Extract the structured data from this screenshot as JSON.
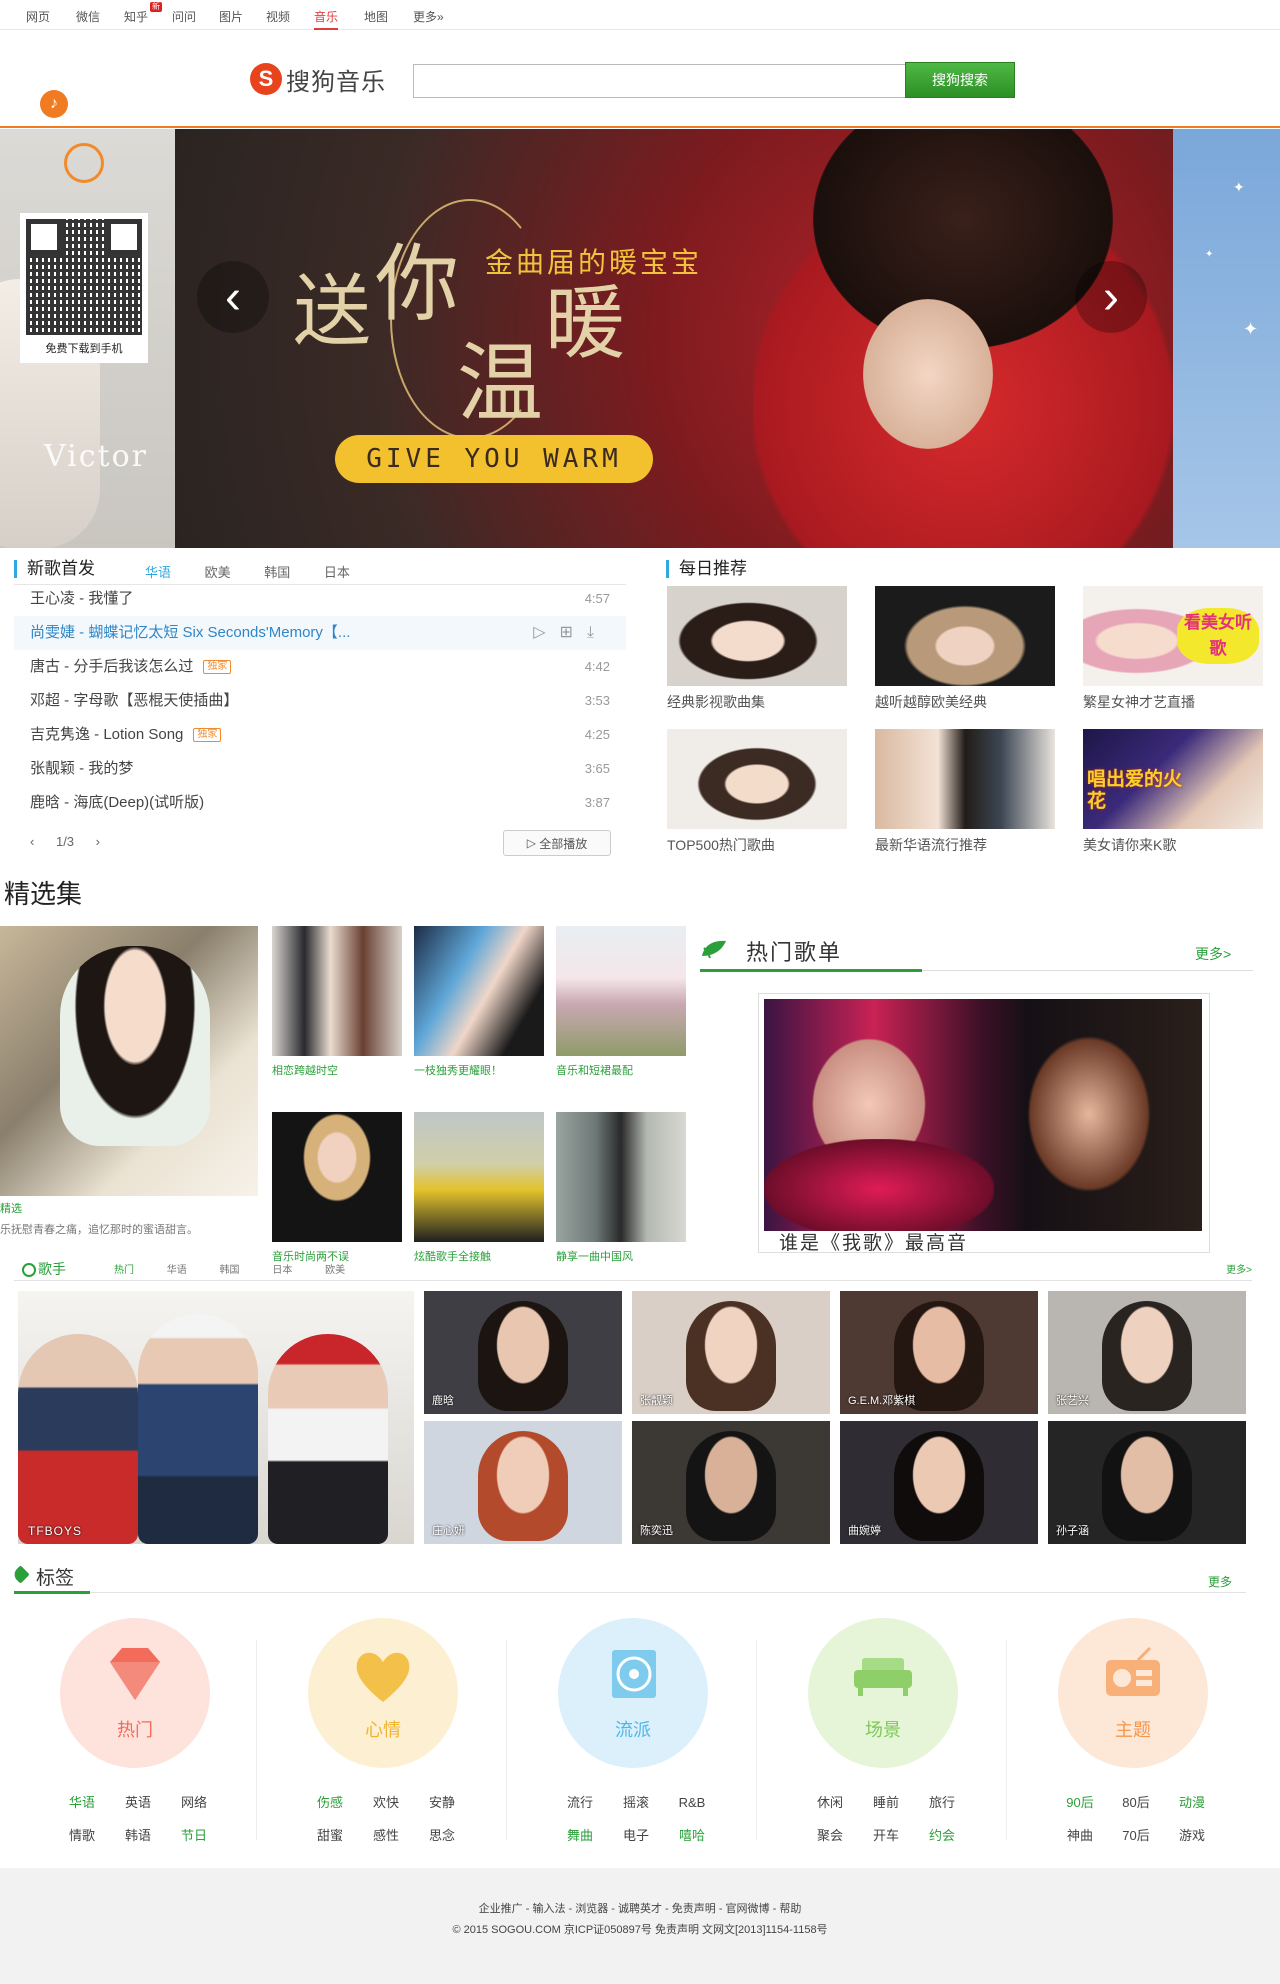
{
  "topnav": {
    "items": [
      "网页",
      "微信",
      "知乎",
      "问问",
      "图片",
      "视频",
      "音乐",
      "地图",
      "更多»"
    ],
    "active": "音乐",
    "new_badge": "新"
  },
  "header": {
    "logo_text": "搜狗音乐",
    "search_value": "",
    "search_button": "搜狗搜索"
  },
  "banner": {
    "left_caption": "免费下载到手机",
    "left_text": "Victor",
    "subtitle": "金曲届的暖宝宝",
    "big1": "送",
    "big2": "你",
    "big3": "温",
    "big4": "暖",
    "button": "GIVE YOU WARM",
    "prev": "‹",
    "next": "›"
  },
  "new_songs": {
    "title": "新歌首发",
    "tabs": [
      "华语",
      "欧美",
      "韩国",
      "日本"
    ],
    "active_tab": "华语",
    "songs": [
      {
        "title": "王心凌 - 我懂了",
        "duration": "4:57"
      },
      {
        "title": "尚雯婕 - 蝴蝶记忆太短 Six Seconds'Memory【...",
        "duration": ""
      },
      {
        "title": "唐古 - 分手后我该怎么过",
        "duration": "4:42",
        "tag": "独家"
      },
      {
        "title": "邓超 - 字母歌【恶棍天使插曲】",
        "duration": "3:53"
      },
      {
        "title": "吉克隽逸 - Lotion Song",
        "duration": "4:25",
        "tag": "独家"
      },
      {
        "title": "张靓颖 - 我的梦",
        "duration": "3:65"
      },
      {
        "title": "鹿晗 - 海底(Deep)(试听版)",
        "duration": "3:87"
      }
    ],
    "pager": {
      "prev": "‹",
      "page": "1/3",
      "next": "›"
    },
    "play_all": "全部播放"
  },
  "daily": {
    "title": "每日推荐",
    "items": [
      {
        "caption": "经典影视歌曲集"
      },
      {
        "caption": "越听越醇欧美经典"
      },
      {
        "caption": "繁星女神才艺直播",
        "overlay": "看美女听歌"
      },
      {
        "caption": "TOP500热门歌曲"
      },
      {
        "caption": "最新华语流行推荐"
      },
      {
        "caption": "美女请你来K歌",
        "overlay": "唱出爱的火花"
      }
    ]
  },
  "jingxuan": {
    "title": "精选集",
    "big_caption": "精选",
    "big_sub": "乐抚慰青春之痛，追忆那时的蜜语甜言。",
    "items": [
      {
        "caption": "相恋跨越时空"
      },
      {
        "caption": "一枝独秀更耀眼！"
      },
      {
        "caption": "音乐和短裙最配"
      },
      {
        "caption": "音乐时尚两不误"
      },
      {
        "caption": "炫酷歌手全接触"
      },
      {
        "caption": "静享一曲中国风"
      }
    ]
  },
  "hot_playlist": {
    "title": "热门歌单",
    "more": "更多>",
    "caption": "谁是《我歌》最高音"
  },
  "singers": {
    "title": "歌手",
    "tabs": [
      "热门",
      "华语",
      "韩国",
      "日本",
      "欧美"
    ],
    "active_tab": "热门",
    "more": "更多>",
    "featured": "TFBOYS",
    "items": [
      "鹿晗",
      "张靓颖",
      "G.E.M.邓紫棋",
      "张艺兴",
      "庄心妍",
      "陈奕迅",
      "曲婉婷",
      "孙子涵"
    ]
  },
  "tags": {
    "title": "标签",
    "more": "更多",
    "groups": [
      {
        "label": "热门",
        "color": "#f26b5b",
        "items": [
          {
            "t": "华语",
            "g": true
          },
          {
            "t": "英语"
          },
          {
            "t": "网络"
          },
          {
            "t": "情歌"
          },
          {
            "t": "韩语"
          },
          {
            "t": "节日",
            "g": true
          }
        ]
      },
      {
        "label": "心情",
        "color": "#f0b431",
        "items": [
          {
            "t": "伤感",
            "g": true
          },
          {
            "t": "欢快"
          },
          {
            "t": "安静"
          },
          {
            "t": "甜蜜"
          },
          {
            "t": "感性"
          },
          {
            "t": "思念"
          }
        ]
      },
      {
        "label": "流派",
        "color": "#4fb7e8",
        "items": [
          {
            "t": "流行"
          },
          {
            "t": "摇滚"
          },
          {
            "t": "R&B"
          },
          {
            "t": "舞曲",
            "g": true
          },
          {
            "t": "电子"
          },
          {
            "t": "嘻哈",
            "g": true
          }
        ]
      },
      {
        "label": "场景",
        "color": "#7ec858",
        "items": [
          {
            "t": "休闲"
          },
          {
            "t": "睡前"
          },
          {
            "t": "旅行"
          },
          {
            "t": "聚会"
          },
          {
            "t": "开车"
          },
          {
            "t": "约会",
            "g": true
          }
        ]
      },
      {
        "label": "主题",
        "color": "#f5964b",
        "items": [
          {
            "t": "90后",
            "g": true
          },
          {
            "t": "80后"
          },
          {
            "t": "动漫",
            "g": true
          },
          {
            "t": "神曲"
          },
          {
            "t": "70后"
          },
          {
            "t": "游戏"
          }
        ]
      }
    ]
  },
  "footer": {
    "line1": "企业推广 - 输入法 - 浏览器 - 诚聘英才 - 免责声明 - 官网微博 - 帮助",
    "line2": "© 2015 SOGOU.COM 京ICP证050897号 免责声明 文网文[2013]1154-1158号"
  }
}
